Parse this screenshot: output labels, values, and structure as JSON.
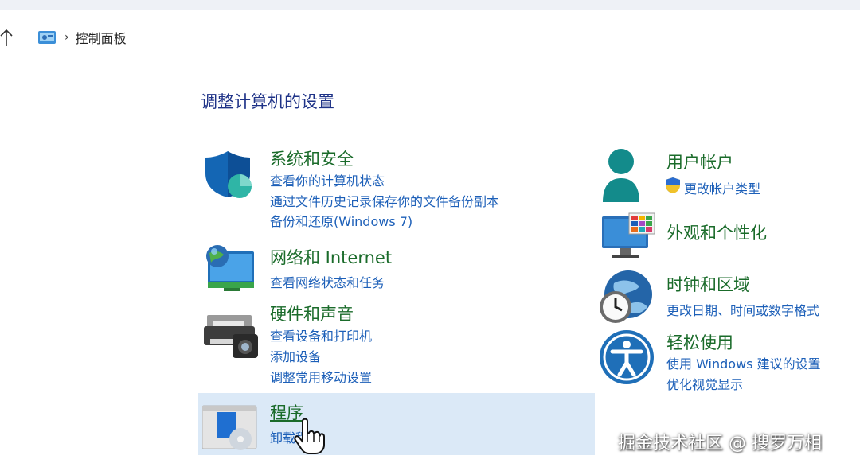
{
  "address": {
    "breadcrumb": "控制面板"
  },
  "page_title": "调整计算机的设置",
  "left_categories": [
    {
      "title": "系统和安全",
      "links": [
        "查看你的计算机状态",
        "通过文件历史记录保存你的文件备份副本",
        "备份和还原(Windows 7)"
      ]
    },
    {
      "title": "网络和 Internet",
      "links": [
        "查看网络状态和任务"
      ]
    },
    {
      "title": "硬件和声音",
      "links": [
        "查看设备和打印机",
        "添加设备",
        "调整常用移动设置"
      ]
    },
    {
      "title": "程序",
      "links": [
        "卸载程序"
      ]
    }
  ],
  "right_categories": [
    {
      "title": "用户帐户",
      "links": [
        "更改帐户类型"
      ]
    },
    {
      "title": "外观和个性化",
      "links": []
    },
    {
      "title": "时钟和区域",
      "links": [
        "更改日期、时间或数字格式"
      ]
    },
    {
      "title": "轻松使用",
      "links": [
        "使用 Windows 建议的设置",
        "优化视觉显示"
      ]
    }
  ],
  "watermark": "掘金技术社区 @ 搜罗万相",
  "colors": {
    "category_title": "#1a6b2a",
    "link": "#1c5fb8",
    "heading": "#1e3287",
    "hover_bg": "#dbe9f7"
  }
}
